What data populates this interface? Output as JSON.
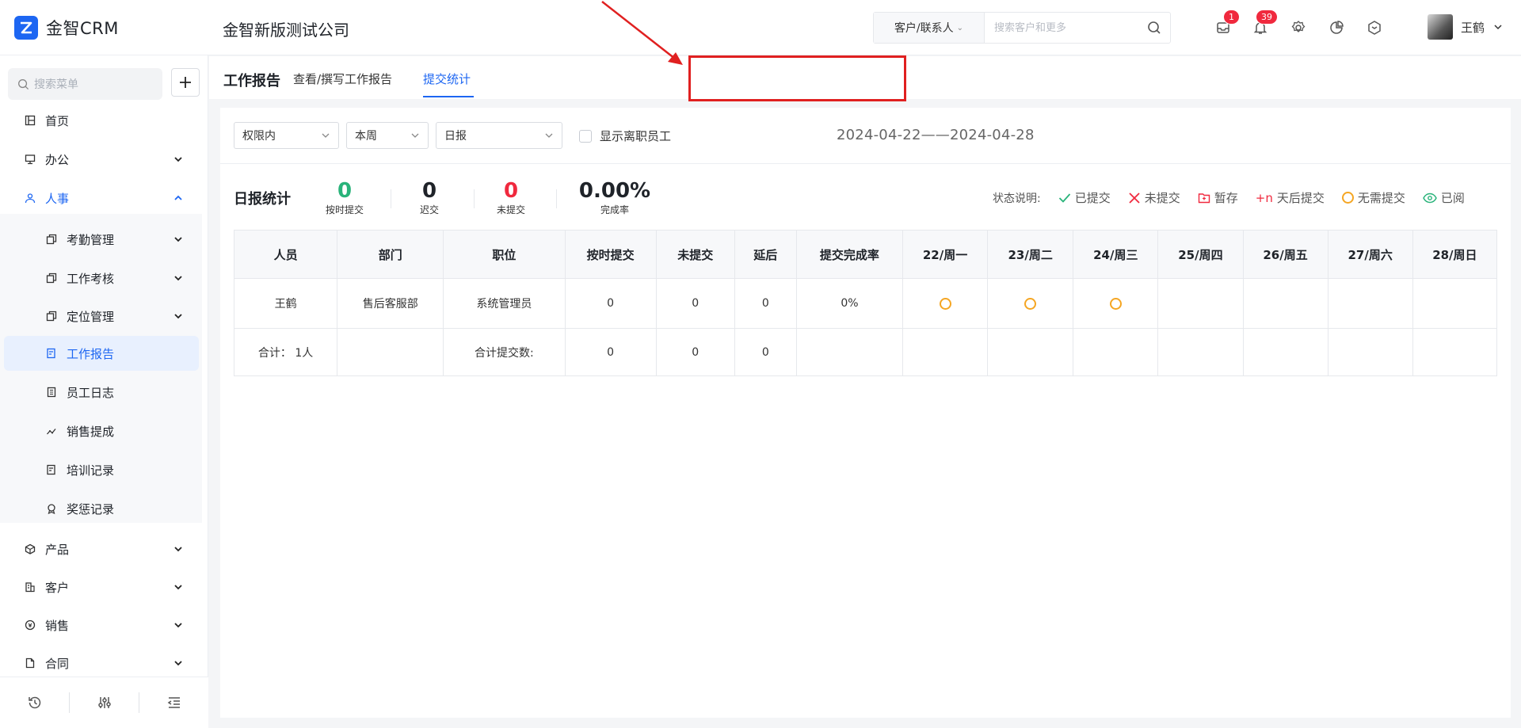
{
  "header": {
    "logo_text": "金智CRM",
    "company": "金智新版测试公司",
    "search_type": "客户/联系人",
    "search_placeholder": "搜索客户和更多",
    "badges": {
      "messages": "1",
      "notifications": "39"
    },
    "user_name": "王鹤"
  },
  "sidebar": {
    "search_placeholder": "搜索菜单",
    "items": {
      "home": "首页",
      "office": "办公",
      "hr": "人事",
      "attendance": "考勤管理",
      "assessment": "工作考核",
      "location": "定位管理",
      "work_report": "工作报告",
      "staff_log": "员工日志",
      "sales_commission": "销售提成",
      "training": "培训记录",
      "rewards": "奖惩记录",
      "product": "产品",
      "customer": "客户",
      "sales": "销售",
      "contract": "合同"
    }
  },
  "tabs": {
    "title": "工作报告",
    "view_write": "查看/撰写工作报告",
    "stats": "提交统计"
  },
  "filters": {
    "scope": "权限内",
    "period": "本周",
    "type": "日报",
    "show_resigned": "显示离职员工",
    "date_range": "2024-04-22——2024-04-28"
  },
  "stats": {
    "title": "日报统计",
    "on_time": {
      "value": "0",
      "label": "按时提交"
    },
    "late": {
      "value": "0",
      "label": "迟交"
    },
    "missing": {
      "value": "0",
      "label": "未提交"
    },
    "completion": {
      "value": "0.00%",
      "label": "完成率"
    }
  },
  "legend": {
    "caption": "状态说明:",
    "submitted": "已提交",
    "not_submitted": "未提交",
    "draft": "暂存",
    "plus_n_prefix": "+n",
    "plus_n": "天后提交",
    "not_required": "无需提交",
    "read": "已阅"
  },
  "colors": {
    "accent": "#1d66f2",
    "green": "#29b37a",
    "red": "#f0293e",
    "orange": "#f5a623"
  },
  "table": {
    "headers": [
      "人员",
      "部门",
      "职位",
      "按时提交",
      "未提交",
      "延后",
      "提交完成率",
      "22/周一",
      "23/周二",
      "24/周三",
      "25/周四",
      "26/周五",
      "27/周六",
      "28/周日"
    ],
    "row": {
      "person": "王鹤",
      "dept": "售后客服部",
      "position": "系统管理员",
      "on_time": "0",
      "missing": "0",
      "delayed": "0",
      "rate": "0%"
    },
    "total": {
      "label": "合计： 1人",
      "submit_label": "合计提交数:",
      "on_time": "0",
      "missing": "0",
      "delayed": "0"
    }
  }
}
